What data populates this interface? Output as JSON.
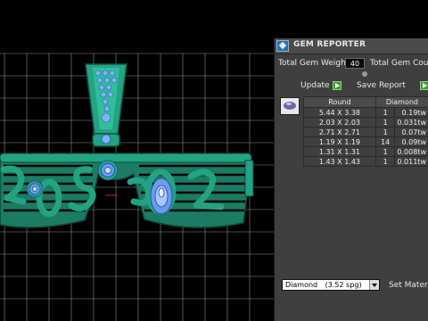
{
  "panel": {
    "title": "GEM REPORTER",
    "total_weight_label": "Total Gem Weight",
    "total_weight_value": "40",
    "total_count_label": "Total Gem Count",
    "update_label": "Update",
    "save_report_label": "Save Report",
    "table": {
      "headers": [
        "Round",
        "Diamond"
      ],
      "rows": [
        {
          "size": "5.44 X 3.38",
          "qty": "1",
          "weight": "0.19tw"
        },
        {
          "size": "2.03 X 2.03",
          "qty": "1",
          "weight": "0.031tw"
        },
        {
          "size": "2.71 X 2.71",
          "qty": "1",
          "weight": "0.07tw"
        },
        {
          "size": "1.19 X 1.19",
          "qty": "14",
          "weight": "0.09tw"
        },
        {
          "size": "1.31 X 1.31",
          "qty": "1",
          "weight": "0.008tw"
        },
        {
          "size": "1.43 X 1.43",
          "qty": "1",
          "weight": "0.011tw"
        }
      ]
    },
    "material_select": {
      "name": "Diamond",
      "detail": "(3.52 spg)"
    },
    "set_material_label": "Set Materia"
  },
  "colors": {
    "model_green": "#23a383",
    "gem_blue": "#5d8fe8",
    "grid": "#8e8e8e",
    "accent_play": "#3e9b2d"
  }
}
